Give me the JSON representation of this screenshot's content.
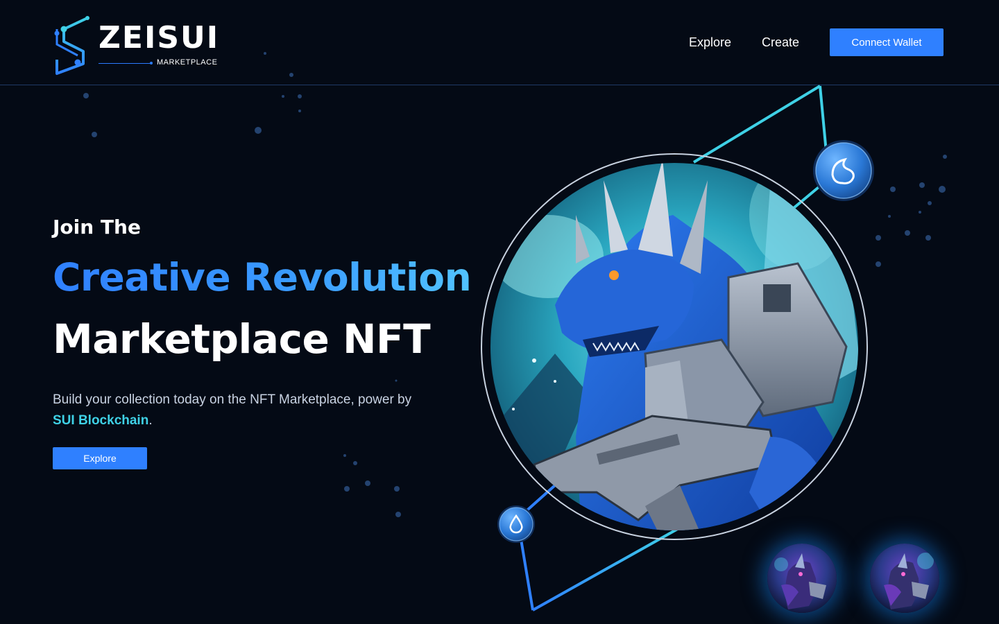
{
  "brand": {
    "name": "ZEISUI",
    "subtitle": "MARKETPLACE",
    "logo_icon": "sui-s-circuit-icon"
  },
  "nav": {
    "links": [
      "Explore",
      "Create"
    ],
    "connect_wallet": "Connect Wallet"
  },
  "hero": {
    "kicker": "Join The",
    "title_line1": "Creative Revolution",
    "title_line2": "Marketplace NFT",
    "description_part1": "Build your collection today on the NFT Marketplace, power by ",
    "description_accent": "SUI Blockchain",
    "description_part2": ".",
    "cta": "Explore"
  },
  "artwork": {
    "main_image": "armored-blue-dragon-with-gun",
    "coin_icons": [
      "sui-coin-icon",
      "water-drop-coin-icon"
    ],
    "thumbnails": [
      "purple-dragon-nft-thumbnail",
      "purple-dragon-nft-thumbnail-2"
    ]
  },
  "colors": {
    "background": "#040a15",
    "accent_blue": "#2f80ff",
    "accent_cyan": "#3fd1e6",
    "divider": "#1f3a66"
  }
}
